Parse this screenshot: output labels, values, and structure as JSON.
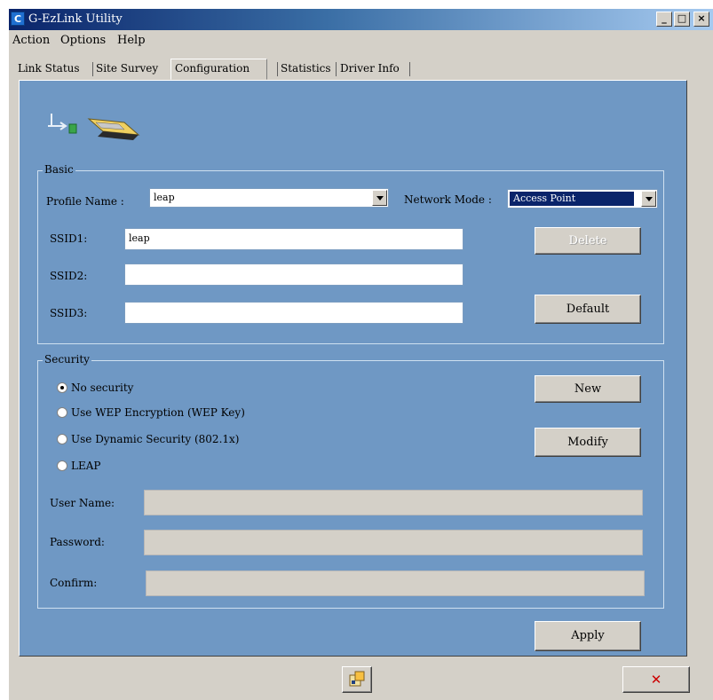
{
  "window": {
    "title": "G-EzLink Utility",
    "app_icon_glyph": "C"
  },
  "menu": {
    "items": [
      "Action",
      "Options",
      "Help"
    ]
  },
  "tabs": [
    {
      "label": "Link Status"
    },
    {
      "label": "Site Survey"
    },
    {
      "label": "Configuration",
      "active": true
    },
    {
      "label": "Statistics"
    },
    {
      "label": "Driver Info"
    }
  ],
  "basic": {
    "group_label": "Basic",
    "profile_name_label": "Profile Name :",
    "profile_name_value": "leap",
    "network_mode_label": "Network Mode :",
    "network_mode_value": "Access Point",
    "ssid1_label": "SSID1:",
    "ssid1_value": "leap",
    "ssid2_label": "SSID2:",
    "ssid2_value": "",
    "ssid3_label": "SSID3:",
    "ssid3_value": "",
    "delete_label": "Delete",
    "default_label": "Default"
  },
  "security": {
    "group_label": "Security",
    "options": [
      {
        "label": "No security",
        "checked": true
      },
      {
        "label": "Use WEP Encryption  (WEP Key)",
        "checked": false
      },
      {
        "label": "Use Dynamic Security  (802.1x)",
        "checked": false
      },
      {
        "label": "LEAP",
        "checked": false
      }
    ],
    "new_label": "New",
    "modify_label": "Modify",
    "user_name_label": "User Name:",
    "password_label": "Password:",
    "confirm_label": "Confirm:"
  },
  "actions": {
    "apply_label": "Apply",
    "close_glyph": "✕"
  },
  "colors": {
    "panel": "#6f98c4",
    "titlebar_start": "#0a246a",
    "close_red": "#cc0000"
  }
}
